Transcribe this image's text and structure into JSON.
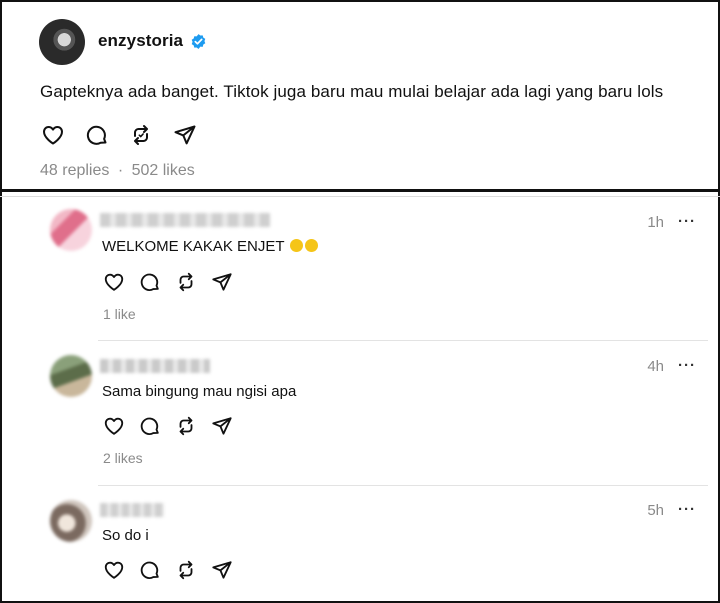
{
  "post": {
    "username": "enzystoria",
    "text": "Gapteknya ada banget. Tiktok juga baru mau mulai belajar ada lagi yang baru lols",
    "replies": "48 replies",
    "dot": "·",
    "likes": "502 likes"
  },
  "replies": [
    {
      "time": "1h",
      "more": "···",
      "text": "WELKOME KAKAK ENJET",
      "emojis": [
        "grinning-squint-face",
        "grinning-squint-face"
      ],
      "likes": "1 like"
    },
    {
      "time": "4h",
      "more": "···",
      "text": "Sama bingung mau ngisi apa",
      "likes": "2 likes"
    },
    {
      "time": "5h",
      "more": "···",
      "text": "So do i"
    }
  ],
  "icons": [
    "heart-icon",
    "comment-icon",
    "repost-icon",
    "share-icon"
  ],
  "colors": {
    "verified": "#1d9bf0",
    "muted": "#8a8a8a",
    "border": "#111111"
  }
}
